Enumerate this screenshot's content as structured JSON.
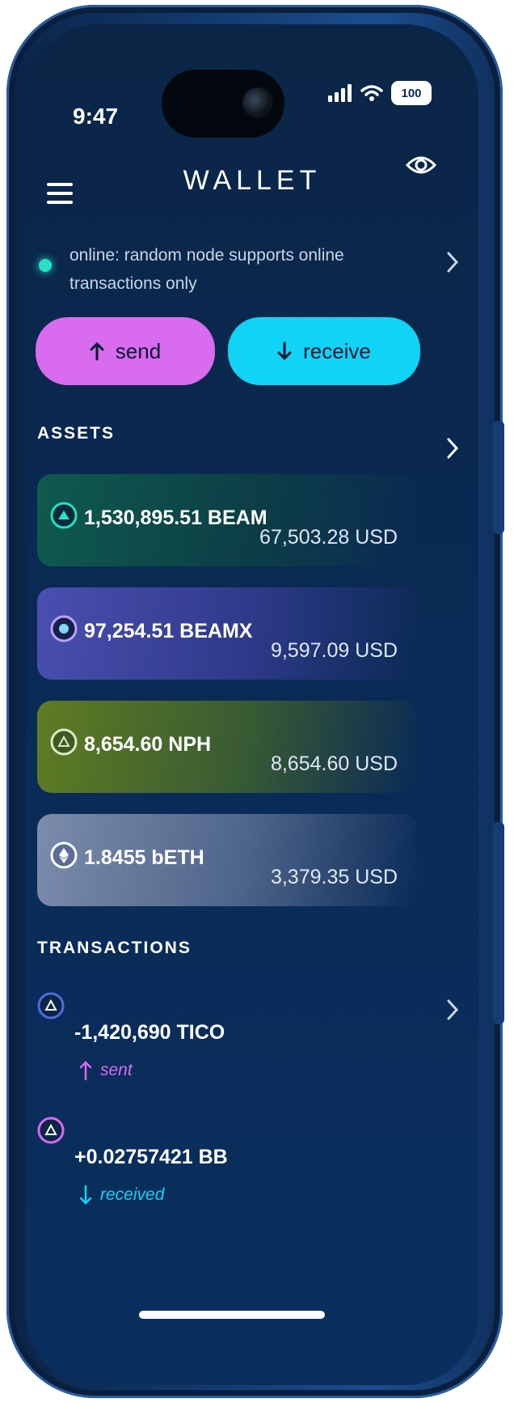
{
  "status_bar": {
    "time": "9:47",
    "battery": "100"
  },
  "header": {
    "title": "WALLET"
  },
  "node_status": {
    "text": "online: random node supports online transactions only"
  },
  "actions": {
    "send_label": "send",
    "receive_label": "receive"
  },
  "assets": {
    "heading": "ASSETS",
    "items": [
      {
        "amount": "1,530,895.51 BEAM",
        "usd": "67,503.28 USD",
        "icon": "beam-icon",
        "color": "#27e0c5"
      },
      {
        "amount": "97,254.51 BEAMX",
        "usd": "9,597.09 USD",
        "icon": "beamx-icon",
        "color": "#7b7fe8"
      },
      {
        "amount": "8,654.60 NPH",
        "usd": "8,654.60 USD",
        "icon": "nph-icon",
        "color": "#a9c23a"
      },
      {
        "amount": "1.8455 bETH",
        "usd": "3,379.35 USD",
        "icon": "eth-icon",
        "color": "#c7cfe0"
      }
    ]
  },
  "transactions": {
    "heading": "TRANSACTIONS",
    "items": [
      {
        "amount": "-1,420,690 TICO",
        "status": "sent",
        "status_color": "#d86bee",
        "icon_color": "#4f6bdf"
      },
      {
        "amount": "+0.02757421 BB",
        "status": "received",
        "status_color": "#11d3f6",
        "icon_color": "#d86bee"
      }
    ]
  }
}
